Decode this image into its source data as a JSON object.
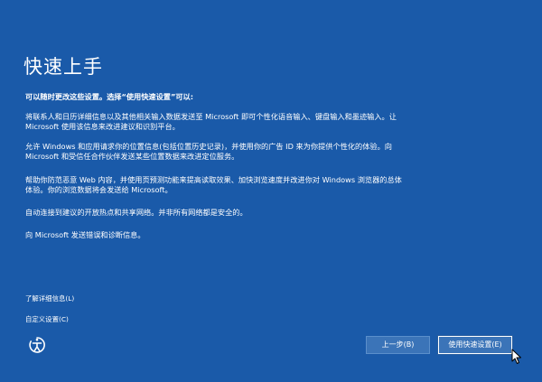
{
  "page": {
    "title": "快速上手",
    "subtitle": "可以随时更改这些设置。选择“使用快速设置”可以:",
    "paragraphs": [
      "将联系人和日历详细信息以及其他相关输入数据发送至 Microsoft 即可个性化语音输入、键盘输入和墨迹输入。让 Microsoft 使用该信息来改进建议和识别平台。",
      "允许 Windows 和应用请求你的位置信息(包括位置历史记录)，并使用你的广告 ID 来为你提供个性化的体验。向 Microsoft 和受信任合作伙伴发送某些位置数据来改进定位服务。",
      "帮助你防范恶意 Web 内容，并使用页预测功能来提高读取效果、加快浏览速度并改进你对 Windows 浏览器的总体体验。你的浏览数据将会发送给 Microsoft。",
      "自动连接到建议的开放热点和共享网络。并非所有网络都是安全的。",
      "向 Microsoft 发送错误和诊断信息。"
    ]
  },
  "links": {
    "learn_more": "了解详细信息(L)",
    "customize": "自定义设置(C)"
  },
  "icons": {
    "accessibility": "ease-of-access-icon",
    "cursor": "mouse-pointer-icon"
  },
  "buttons": {
    "back": "上一步(B)",
    "use_express": "使用快速设置(E)"
  },
  "colors": {
    "background": "#1a5aa9",
    "button": "#3b74b8",
    "text": "#ffffff"
  }
}
